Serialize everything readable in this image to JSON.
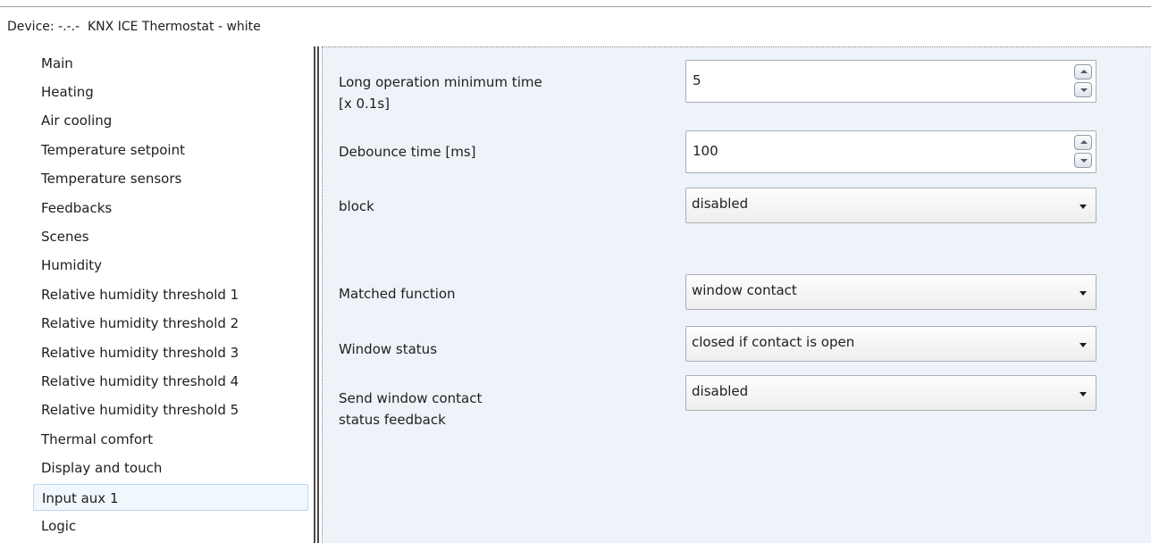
{
  "device_title": "Device: -.-.-  KNX ICE Thermostat - white",
  "sidebar": {
    "items": [
      {
        "label": "Main"
      },
      {
        "label": "Heating"
      },
      {
        "label": "Air cooling"
      },
      {
        "label": "Temperature setpoint"
      },
      {
        "label": "Temperature sensors"
      },
      {
        "label": "Feedbacks"
      },
      {
        "label": "Scenes"
      },
      {
        "label": "Humidity"
      },
      {
        "label": "Relative humidity threshold 1"
      },
      {
        "label": "Relative humidity threshold 2"
      },
      {
        "label": "Relative humidity threshold 3"
      },
      {
        "label": "Relative humidity threshold 4"
      },
      {
        "label": "Relative humidity threshold 5"
      },
      {
        "label": "Thermal comfort"
      },
      {
        "label": "Display and touch"
      },
      {
        "label": "Input aux 1"
      },
      {
        "label": "Logic"
      }
    ],
    "selected": "Input aux 1"
  },
  "params": {
    "long_operation": {
      "label": "Long operation minimum time\n[x 0.1s]",
      "value": "5"
    },
    "debounce": {
      "label": "Debounce time [ms]",
      "value": "100"
    },
    "block": {
      "label": "block",
      "value": "disabled"
    },
    "matched_function": {
      "label": "Matched function",
      "value": "window contact"
    },
    "window_status": {
      "label": "Window status",
      "value": "closed if contact is open"
    },
    "send_feedback": {
      "label": "Send window contact\nstatus feedback",
      "value": "disabled"
    }
  },
  "icons": {
    "spin_up": "chevron-up-icon",
    "spin_down": "chevron-down-icon",
    "dropdown": "dropdown-arrow-icon"
  },
  "colors": {
    "panel_background": "#eef3f9",
    "selected_item_background": "#f0f7fd",
    "selected_item_border": "#bcd9f3"
  }
}
